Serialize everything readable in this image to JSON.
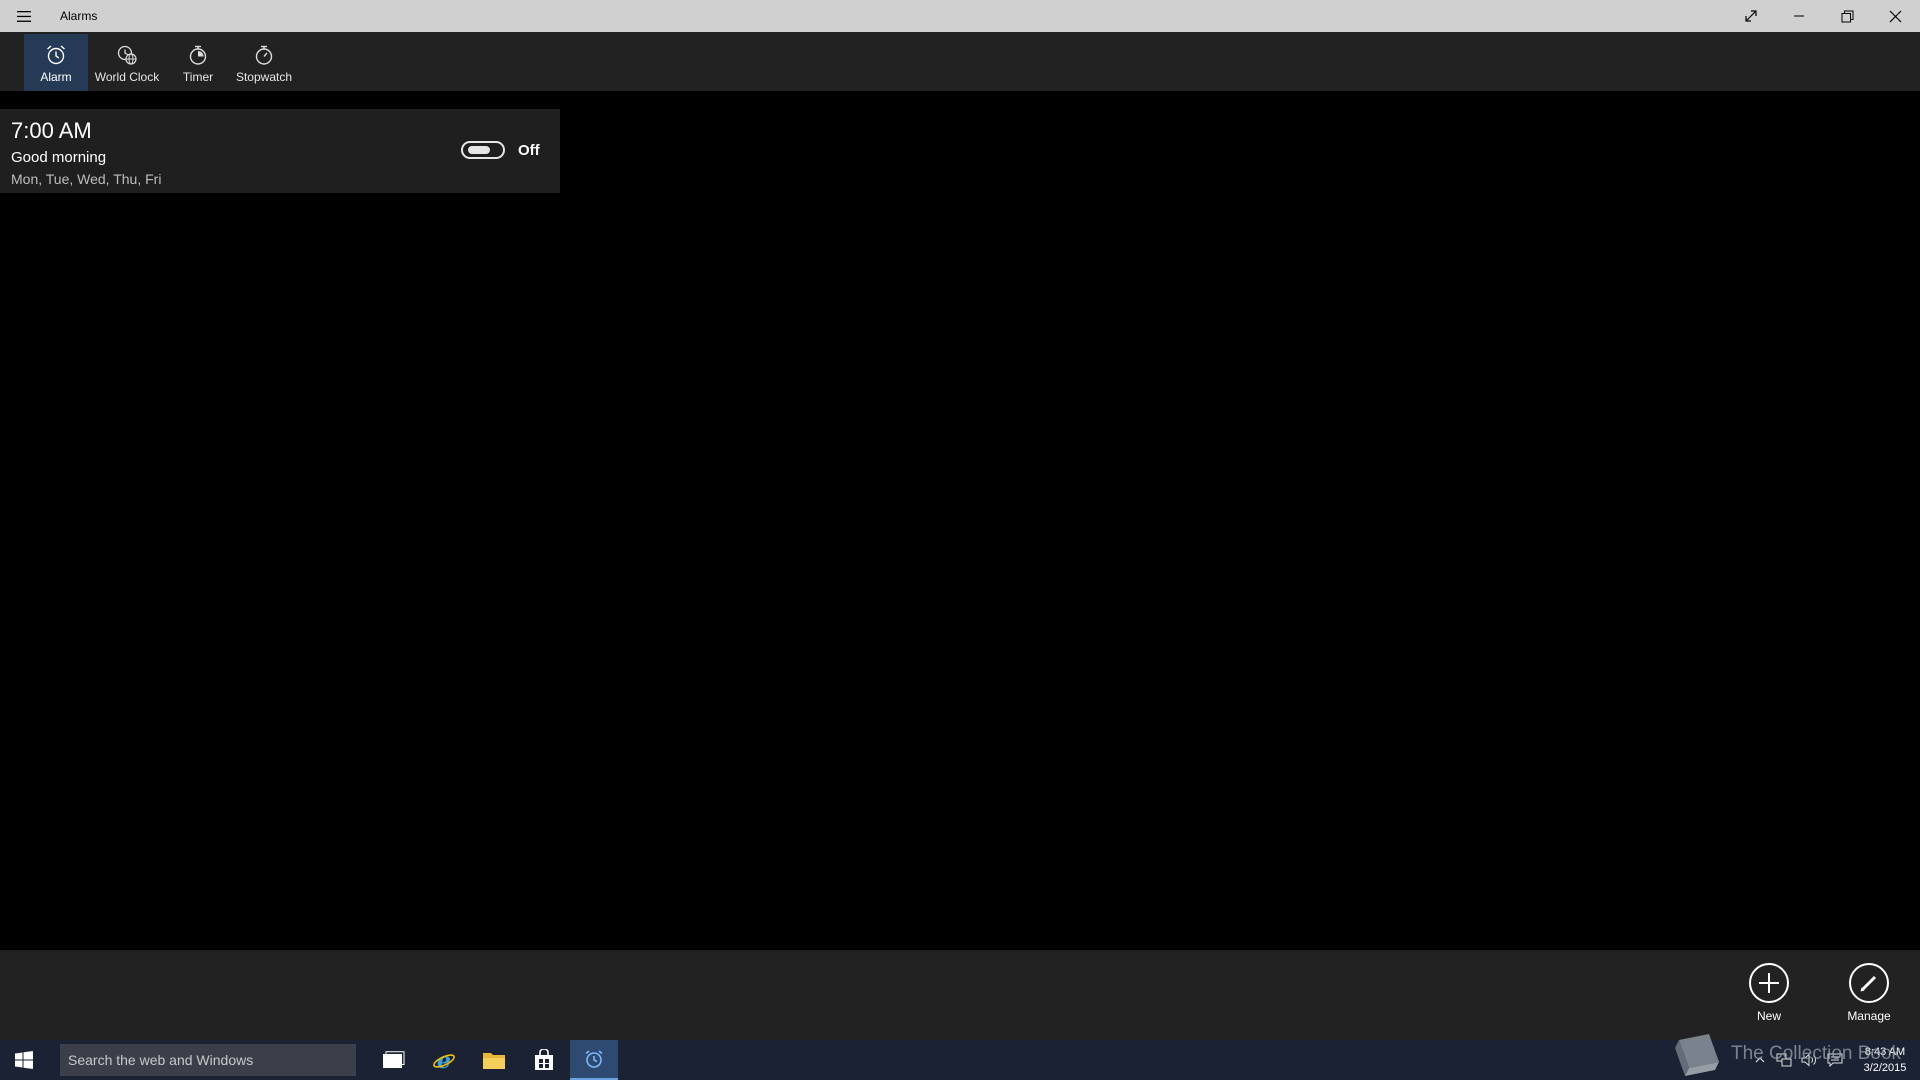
{
  "window": {
    "title": "Alarms"
  },
  "nav": {
    "tabs": [
      {
        "label": "Alarm",
        "icon": "alarm-clock-icon",
        "active": true
      },
      {
        "label": "World Clock",
        "icon": "world-clock-icon",
        "active": false
      },
      {
        "label": "Timer",
        "icon": "timer-icon",
        "active": false
      },
      {
        "label": "Stopwatch",
        "icon": "stopwatch-icon",
        "active": false
      }
    ]
  },
  "alarm": {
    "time": "7:00 AM",
    "name": "Good morning",
    "days": "Mon, Tue, Wed, Thu, Fri",
    "state": "Off",
    "enabled": false
  },
  "commands": {
    "new_label": "New",
    "manage_label": "Manage"
  },
  "taskbar": {
    "search_placeholder": "Search the web and Windows",
    "time": "8:43 AM",
    "date": "3/2/2015"
  },
  "watermark": {
    "text": "The Collection Book"
  },
  "colors": {
    "accent": "#253a55",
    "titlebar": "#d0d0d0",
    "panel": "#222222",
    "card": "#1f1f1f",
    "taskbar": "#1a2233"
  }
}
